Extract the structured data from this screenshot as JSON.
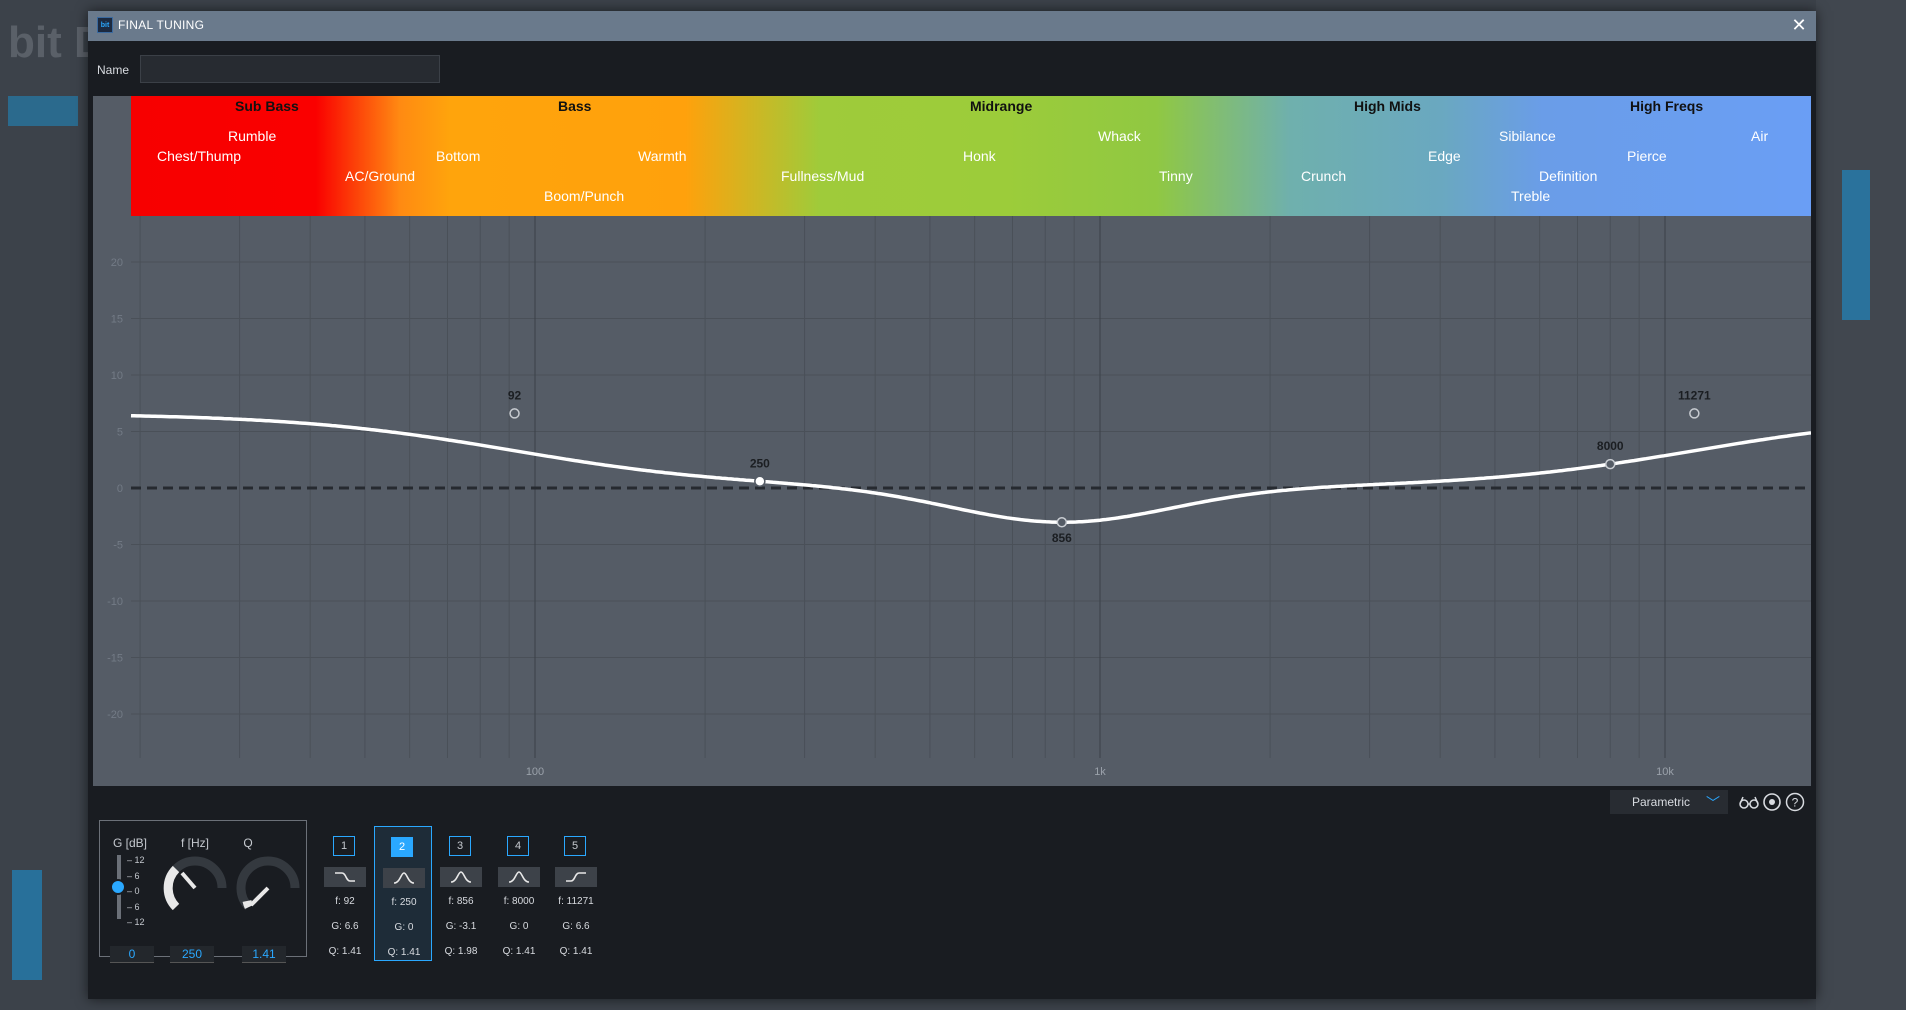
{
  "dialog": {
    "title": "FINAL TUNING",
    "app_icon": "app-logo-icon",
    "close_icon": "close-icon"
  },
  "name_field": {
    "label": "Name",
    "value": ""
  },
  "bands_overlay": {
    "headers": [
      "Sub Bass",
      "Bass",
      "Midrange",
      "High Mids",
      "High Freqs"
    ],
    "labels": [
      "Rumble",
      "Chest/Thump",
      "AC/Ground",
      "Bottom",
      "Boom/Punch",
      "Warmth",
      "Fullness/Mud",
      "Honk",
      "Whack",
      "Tinny",
      "Crunch",
      "Edge",
      "Sibilance",
      "Treble",
      "Definition",
      "Pierce",
      "Air"
    ]
  },
  "graph": {
    "y_labels": [
      "20",
      "15",
      "10",
      "5",
      "0",
      "-5",
      "-10",
      "-15",
      "-20"
    ],
    "x_labels": [
      "100",
      "1k",
      "10k"
    ],
    "points": [
      {
        "label": "92",
        "f": 92,
        "gain": 6.6
      },
      {
        "label": "250",
        "f": 250,
        "gain": 0
      },
      {
        "label": "856",
        "f": 856,
        "gain": -3.1
      },
      {
        "label": "8000",
        "f": 8000,
        "gain": 0
      },
      {
        "label": "11271",
        "f": 11271,
        "gain": 6.6
      }
    ]
  },
  "toolbar": {
    "mode": "Parametric",
    "icons": [
      "glasses-icon",
      "reset-icon",
      "help-icon"
    ]
  },
  "controls": {
    "gain_header": "G [dB]",
    "freq_header": "f [Hz]",
    "q_header": "Q",
    "gain_ticks": [
      "12",
      "6",
      "0",
      "6",
      "12"
    ],
    "gain_value": "0",
    "freq_value": "250",
    "q_value": "1.41"
  },
  "bands": [
    {
      "num": "1",
      "type": "low-shelf-icon",
      "f": "f:  92",
      "g": "G:  6.6",
      "q": "Q:  1.41"
    },
    {
      "num": "2",
      "type": "peak-filter-icon",
      "f": "f:  250",
      "g": "G:  0",
      "q": "Q:  1.41"
    },
    {
      "num": "3",
      "type": "peak-filter-icon",
      "f": "f:  856",
      "g": "G:  -3.1",
      "q": "Q:  1.98"
    },
    {
      "num": "4",
      "type": "peak-filter-icon",
      "f": "f:  8000",
      "g": "G:  0",
      "q": "Q:  1.41"
    },
    {
      "num": "5",
      "type": "high-shelf-icon",
      "f": "f:  11271",
      "g": "G:  6.6",
      "q": "Q:  1.41"
    }
  ],
  "colors": {
    "accent": "#2aa8ff",
    "sub_bass": "#ff0000",
    "bass": "#ffa10c",
    "midrange": "#9ccc3a",
    "high_mids": "#6aa8c0",
    "high_freqs": "#6a9ef5"
  }
}
